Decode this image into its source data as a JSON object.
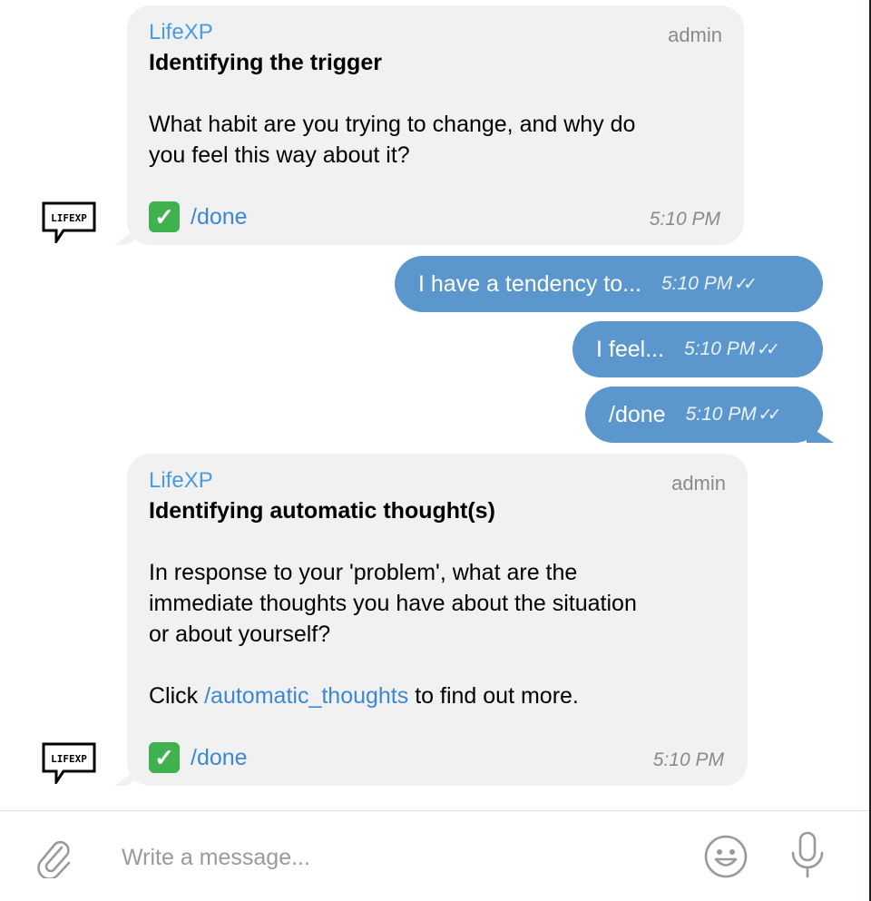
{
  "messages": [
    {
      "sender": "LifeXP",
      "role": "admin",
      "title": "Identifying the trigger",
      "body": [
        "What habit are you trying to change, and why do",
        "you feel this way about it?"
      ],
      "command": "/done",
      "time": "5:10 PM"
    },
    {
      "text": "I have a tendency to...",
      "time": "5:10 PM"
    },
    {
      "text": "I feel...",
      "time": "5:10 PM"
    },
    {
      "text": "/done",
      "time": "5:10 PM"
    },
    {
      "sender": "LifeXP",
      "role": "admin",
      "title": "Identifying automatic thought(s)",
      "body": [
        "In response to your 'problem', what are the",
        "immediate thoughts you have about the situation",
        "or about yourself?"
      ],
      "click_prefix": "Click ",
      "click_link": "/automatic_thoughts",
      "click_suffix": " to find out more.",
      "command": "/done",
      "time": "5:10 PM"
    }
  ],
  "avatar_label": "LIFEXP",
  "composer": {
    "placeholder": "Write a message..."
  },
  "icons": {
    "attach": "paperclip-icon",
    "emoji": "emoji-icon",
    "mic": "microphone-icon",
    "read": "double-check-icon",
    "done": "check-mark-emoji"
  }
}
